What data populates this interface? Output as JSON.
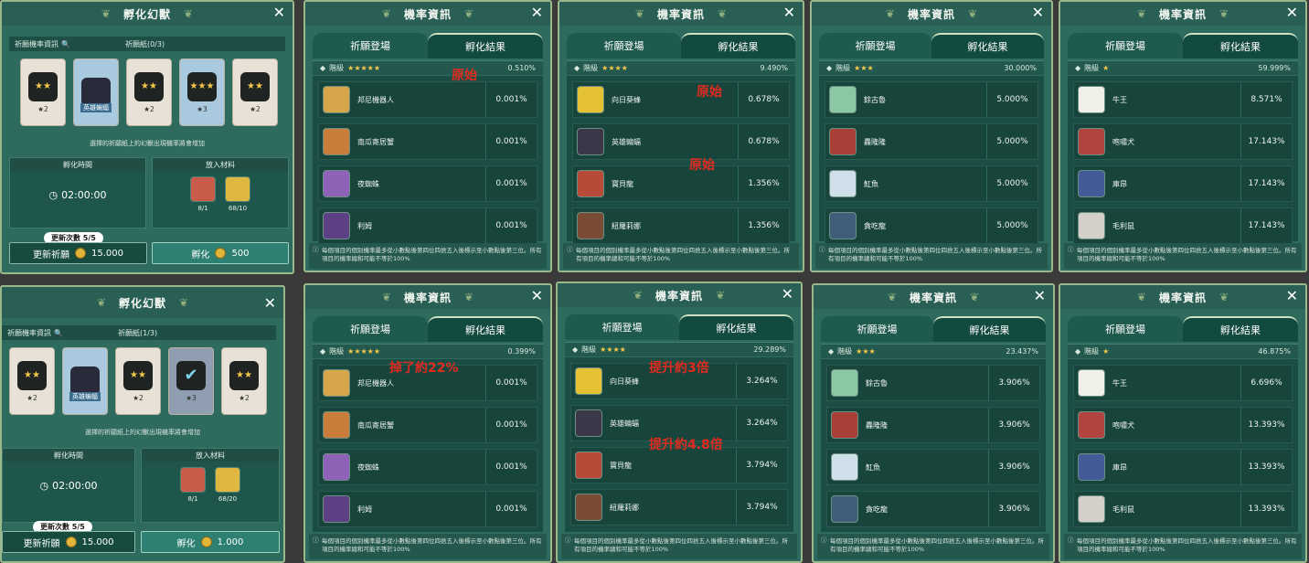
{
  "incubate": [
    {
      "title": "孵化幻獸",
      "wish_label": "祈願機率資訊",
      "wish_count": "祈願紙(0/3)",
      "cards": [
        {
          "stars": "★★",
          "level": "★2",
          "tag": ""
        },
        {
          "stars": "",
          "level": "",
          "tag": "英雄蝙蝠"
        },
        {
          "stars": "★★",
          "level": "★2",
          "tag": ""
        },
        {
          "stars": "★★★",
          "level": "★3",
          "tag": ""
        },
        {
          "stars": "★★",
          "level": "★2",
          "tag": ""
        }
      ],
      "hint": "選擇的祈願紙上的幻獸出現機率將會增加",
      "time_label": "孵化時間",
      "time_value": "02:00:00",
      "material_label": "放入材料",
      "materials": [
        {
          "count": "8/1"
        },
        {
          "count": "68/10"
        }
      ],
      "refresh_count": "更新次數 5/5",
      "refresh_label": "更新祈願",
      "refresh_cost": "15.000",
      "hatch_label": "孵化",
      "hatch_cost": "500"
    },
    {
      "title": "孵化幻獸",
      "wish_label": "祈願機率資訊",
      "wish_count": "祈願紙(1/3)",
      "cards": [
        {
          "stars": "★★",
          "level": "★2",
          "tag": ""
        },
        {
          "stars": "",
          "level": "",
          "tag": "英雄蝙蝠"
        },
        {
          "stars": "★★",
          "level": "★2",
          "tag": ""
        },
        {
          "stars": "✔",
          "level": "★3",
          "tag": ""
        },
        {
          "stars": "★★",
          "level": "★2",
          "tag": ""
        }
      ],
      "hint": "選擇的祈願紙上的幻獸出現機率將會增加",
      "time_label": "孵化時間",
      "time_value": "02:00:00",
      "material_label": "放入材料",
      "materials": [
        {
          "count": "8/1"
        },
        {
          "count": "68/20"
        }
      ],
      "refresh_count": "更新次數 5/5",
      "refresh_label": "更新祈願",
      "refresh_cost": "15.000",
      "hatch_label": "孵化",
      "hatch_cost": "1.000"
    }
  ],
  "prob_common": {
    "title": "機率資訊",
    "tab_left": "祈願登場",
    "tab_right": "孵化結果",
    "tier_label": "階級",
    "footer": "每個項目的個別機率最多從小數點後第四位四捨五入後標示至小數點後第三位。所有項目的機率總和可能不等於100%"
  },
  "prob": [
    {
      "tier_stars": "★★★★★",
      "tier_pct": "0.510%",
      "rows": [
        {
          "name": "邦尼機器人",
          "value": "0.001%"
        },
        {
          "name": "南瓜寄居蟹",
          "value": "0.001%"
        },
        {
          "name": "夜蜘蛛",
          "value": "0.001%"
        },
        {
          "name": "利姆",
          "value": "0.001%"
        }
      ],
      "notes": [
        "原始"
      ]
    },
    {
      "tier_stars": "★★★★",
      "tier_pct": "9.490%",
      "rows": [
        {
          "name": "向日葵蜂",
          "value": "0.678%"
        },
        {
          "name": "英雄蝙蝠",
          "value": "0.678%"
        },
        {
          "name": "寶貝龍",
          "value": "1.356%"
        },
        {
          "name": "紐羅莉娜",
          "value": "1.356%"
        }
      ],
      "notes": [
        "原始",
        "原始"
      ]
    },
    {
      "tier_stars": "★★★",
      "tier_pct": "30.000%",
      "rows": [
        {
          "name": "餘古魯",
          "value": "5.000%"
        },
        {
          "name": "轟隆隆",
          "value": "5.000%"
        },
        {
          "name": "魟魚",
          "value": "5.000%"
        },
        {
          "name": "貪吃龍",
          "value": "5.000%"
        }
      ],
      "notes": []
    },
    {
      "tier_stars": "★",
      "tier_pct": "59.999%",
      "rows": [
        {
          "name": "牛王",
          "value": "8.571%"
        },
        {
          "name": "咆嘯犬",
          "value": "17.143%"
        },
        {
          "name": "庫昂",
          "value": "17.143%"
        },
        {
          "name": "毛利鼠",
          "value": "17.143%"
        }
      ],
      "notes": []
    },
    {
      "tier_stars": "★★★★★",
      "tier_pct": "0.399%",
      "rows": [
        {
          "name": "邦尼機器人",
          "value": "0.001%"
        },
        {
          "name": "南瓜寄居蟹",
          "value": "0.001%"
        },
        {
          "name": "夜蜘蛛",
          "value": "0.001%"
        },
        {
          "name": "利姆",
          "value": "0.001%"
        }
      ],
      "notes": [
        "掉了約22%"
      ]
    },
    {
      "tier_stars": "★★★★",
      "tier_pct": "29.289%",
      "rows": [
        {
          "name": "向日葵蜂",
          "value": "3.264%"
        },
        {
          "name": "英雄蝙蝠",
          "value": "3.264%"
        },
        {
          "name": "寶貝龍",
          "value": "3.794%"
        },
        {
          "name": "紐羅莉娜",
          "value": "3.794%"
        }
      ],
      "notes": [
        "提升約3倍",
        "提升約4.8倍"
      ]
    },
    {
      "tier_stars": "★★★",
      "tier_pct": "23.437%",
      "rows": [
        {
          "name": "餘古魯",
          "value": "3.906%"
        },
        {
          "name": "轟隆隆",
          "value": "3.906%"
        },
        {
          "name": "魟魚",
          "value": "3.906%"
        },
        {
          "name": "貪吃龍",
          "value": "3.906%"
        }
      ],
      "notes": []
    },
    {
      "tier_stars": "★",
      "tier_pct": "46.875%",
      "rows": [
        {
          "name": "牛王",
          "value": "6.696%"
        },
        {
          "name": "咆嘯犬",
          "value": "13.393%"
        },
        {
          "name": "庫昂",
          "value": "13.393%"
        },
        {
          "name": "毛利鼠",
          "value": "13.393%"
        }
      ],
      "notes": []
    }
  ],
  "colors": {
    "panel": "#2e6a5e",
    "note_red": "#e02b20",
    "star": "#f5c84a"
  }
}
